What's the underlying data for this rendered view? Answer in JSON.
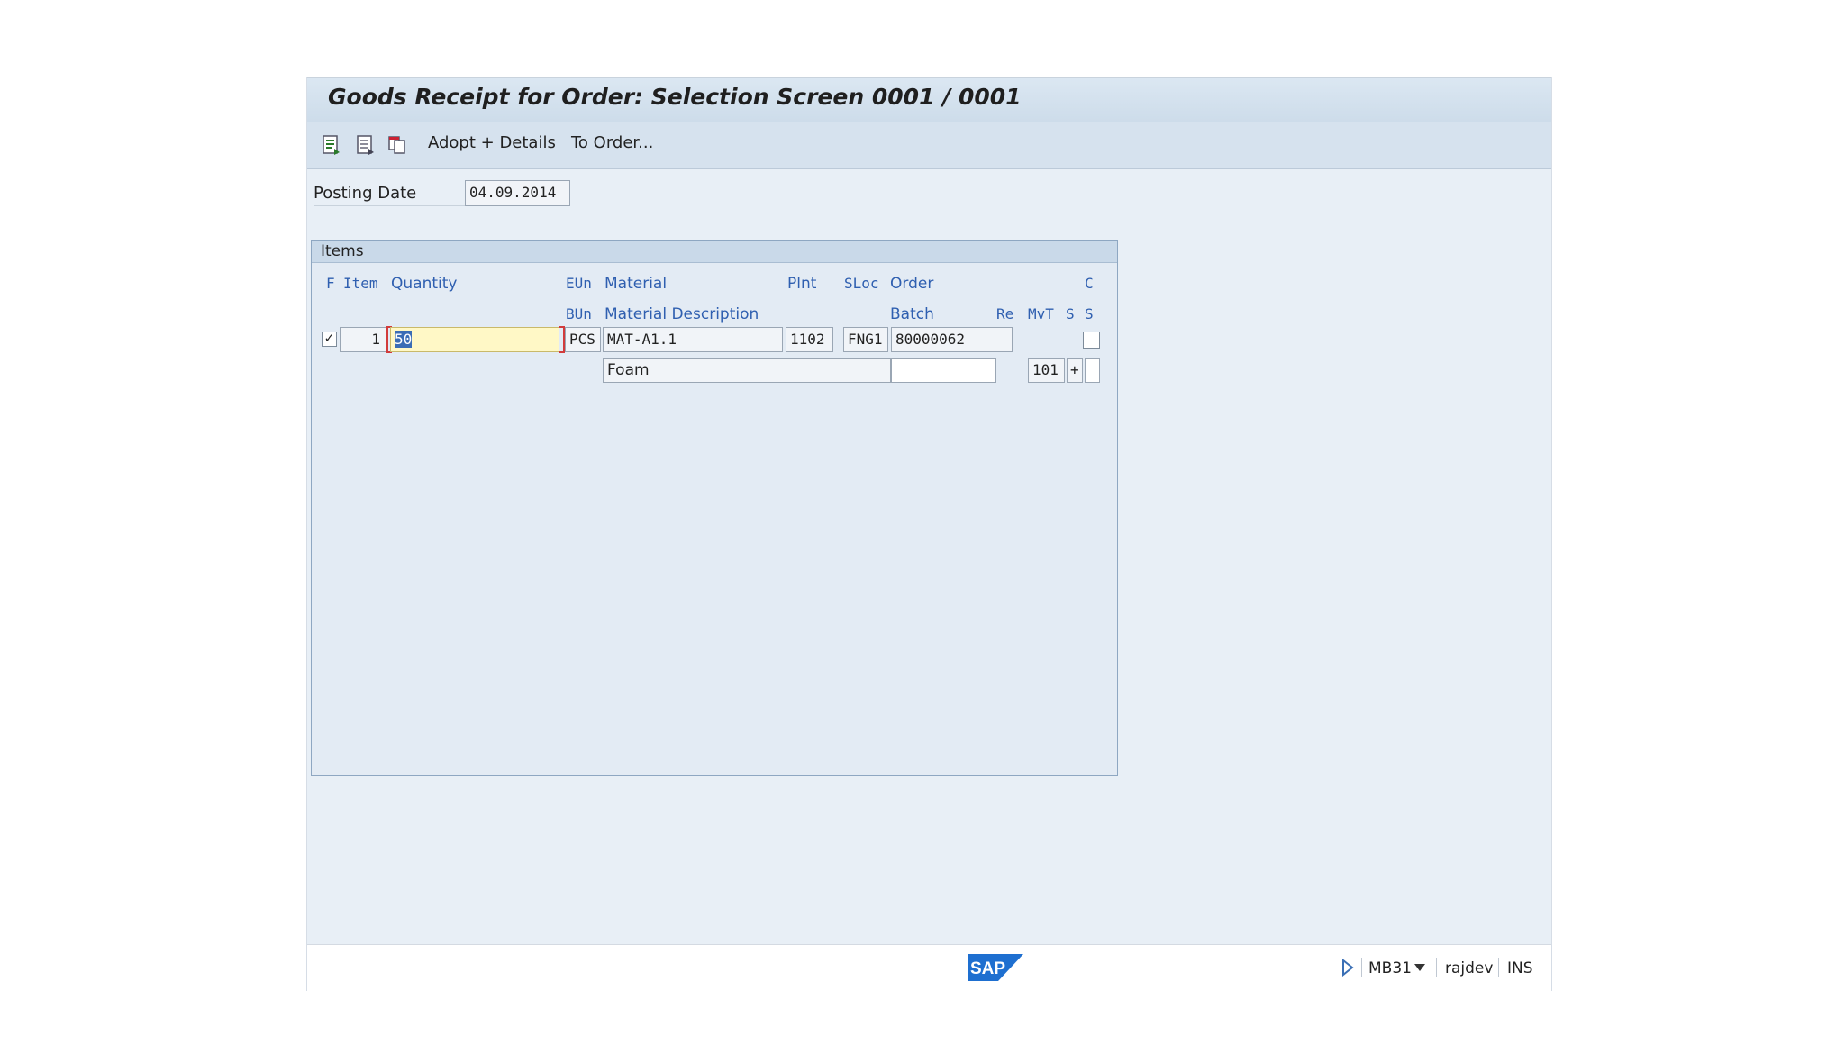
{
  "window": {
    "title": "Goods Receipt for Order: Selection Screen 0001 / 0001"
  },
  "toolbar": {
    "icons": [
      "execute-icon",
      "detail-icon",
      "copy-icon"
    ],
    "adopt_details_label": "Adopt + Details",
    "to_order_label": "To Order..."
  },
  "header": {
    "posting_date_label": "Posting Date",
    "posting_date_value": "04.09.2014"
  },
  "items": {
    "title": "Items",
    "columns_row1": {
      "f": "F",
      "item": "Item",
      "quantity": "Quantity",
      "eun": "EUn",
      "material": "Material",
      "plnt": "Plnt",
      "sloc": "SLoc",
      "order": "Order",
      "c": "C"
    },
    "columns_row2": {
      "bun": "BUn",
      "material_description": "Material Description",
      "batch": "Batch",
      "re": "Re",
      "mvt": "MvT",
      "s1": "S",
      "s2": "S"
    },
    "rows": [
      {
        "checked": true,
        "checkmark": "✓",
        "item": "1",
        "quantity": "50",
        "eun": "PCS",
        "material": "MAT-A1.1",
        "plnt": "1102",
        "sloc": "FNG1",
        "order": "80000062",
        "material_description": "Foam",
        "batch": "",
        "mvt": "101",
        "sign": "+"
      }
    ]
  },
  "statusbar": {
    "logo": "SAP",
    "transaction": "MB31",
    "user": "rajdev",
    "mode": "INS"
  }
}
